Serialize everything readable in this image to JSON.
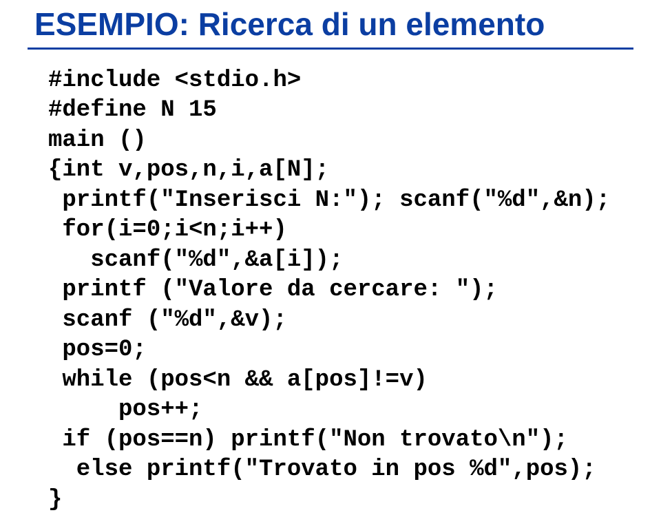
{
  "slide": {
    "title": "ESEMPIO: Ricerca di un elemento",
    "code": {
      "l1": "#include <stdio.h>",
      "l2": "#define N 15",
      "l3": "main ()",
      "l4": "{int v,pos,n,i,a[N];",
      "l5": " printf(\"Inserisci N:\"); scanf(\"%d\",&n);",
      "l6": " for(i=0;i<n;i++)",
      "l7": "   scanf(\"%d\",&a[i]);",
      "l8": " printf (\"Valore da cercare: \");",
      "l9": " scanf (\"%d\",&v);",
      "l10": " pos=0;",
      "l11": " while (pos<n && a[pos]!=v)",
      "l12": "     pos++;",
      "l13": " if (pos==n) printf(\"Non trovato\\n\");",
      "l14": "  else printf(\"Trovato in pos %d\",pos);",
      "l15": "}"
    }
  }
}
